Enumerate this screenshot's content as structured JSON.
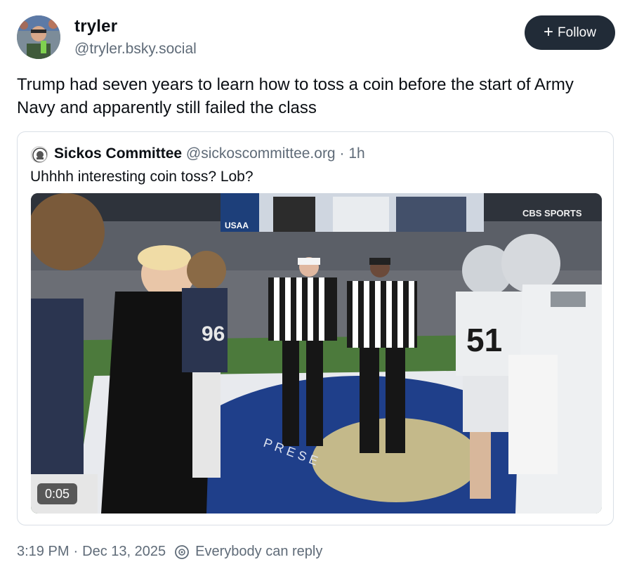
{
  "author": {
    "name": "tryler",
    "handle": "@tryler.bsky.social",
    "avatar_icon": "user-avatar"
  },
  "follow_button": {
    "icon": "plus-icon",
    "plus": "+",
    "label": "Follow"
  },
  "post": {
    "text": "Trump had seven years to learn how to toss a coin before the start of Army Navy and apparently still failed the class"
  },
  "quote": {
    "author_name": "Sickos Committee",
    "author_handle": "@sickoscommittee.org",
    "separator": "·",
    "age": "1h",
    "text": "Uhhhh interesting coin toss? Lob?",
    "video": {
      "duration": "0:05",
      "broadcaster": "CBS SPORTS",
      "sponsor": "USAA",
      "jersey_numbers": [
        "96",
        "51"
      ]
    }
  },
  "footer": {
    "time": "3:19 PM",
    "separator": "·",
    "date": "Dec 13, 2025",
    "reply_icon": "reply-settings-icon",
    "reply_setting": "Everybody can reply"
  },
  "colors": {
    "follow_bg": "#212b37",
    "muted_text": "#5f6b78",
    "border": "#d9dfe6"
  }
}
